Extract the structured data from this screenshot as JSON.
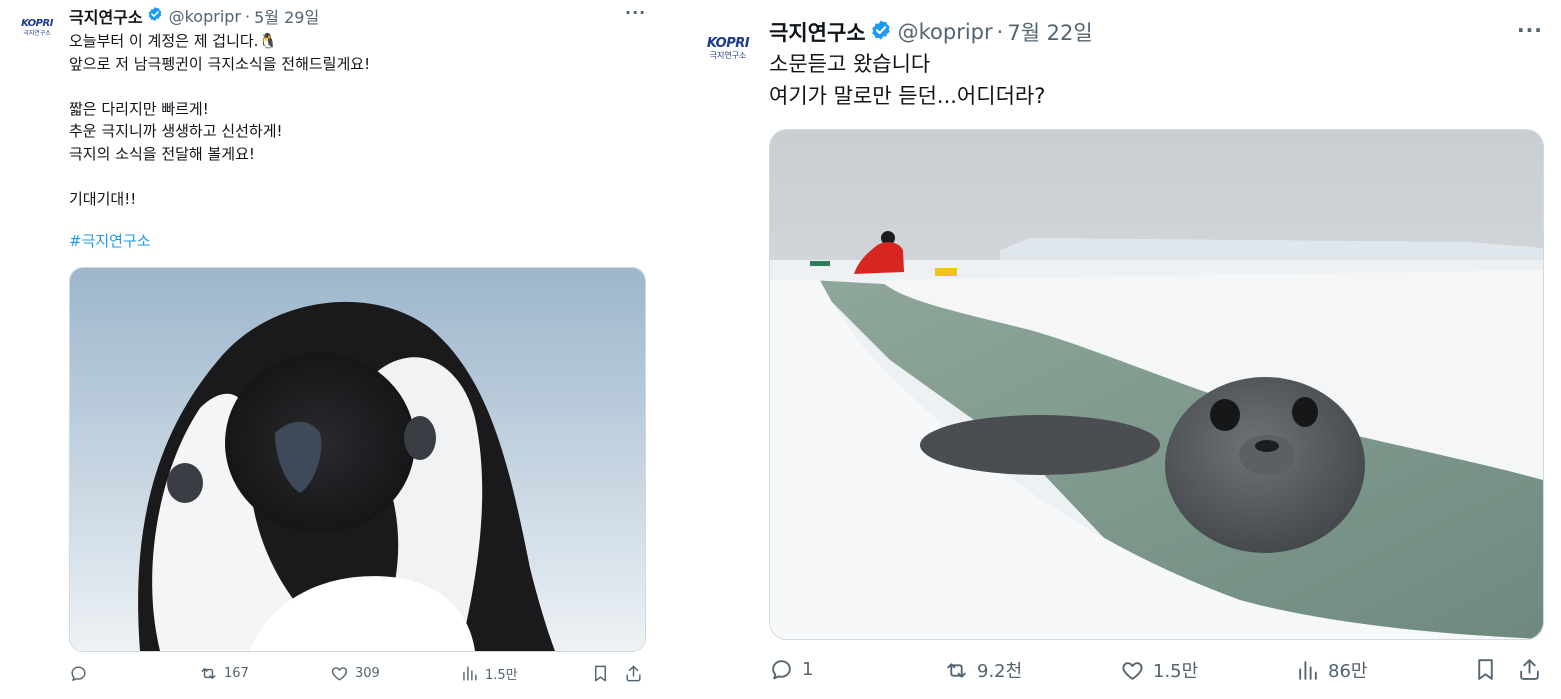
{
  "tweets": [
    {
      "logo_text": "KOPRI",
      "logo_sub": "극지연구소",
      "author_name": "극지연구소",
      "handle": "@kopripr",
      "separator": "·",
      "date": "5월 29일",
      "more": "···",
      "text": "오늘부터 이 계정은 제 겁니다.🐧\n앞으로 저 남극펭귄이 극지소식을 전해드릴게요!\n\n짧은 다리지만 빠르게!\n추운 극지니까 생생하고 신선하게!\n극지의 소식을 전달해 볼게요!\n\n기대기대!!",
      "hashtag": "#극지연구소",
      "stats": {
        "reply": "",
        "retweet": "167",
        "like": "309",
        "views": "1.5만"
      }
    },
    {
      "logo_text": "KOPRI",
      "logo_sub": "극지연구소",
      "author_name": "극지연구소",
      "handle": "@kopripr",
      "separator": "·",
      "date": "7월 22일",
      "more": "···",
      "text": "소문듣고 왔습니다\n여기가 말로만 듣던...어디더라?",
      "stats": {
        "reply": "1",
        "retweet": "9.2천",
        "like": "1.5만",
        "views": "86만"
      }
    }
  ],
  "colors": {
    "verified": "#1d9bf0",
    "hashtag": "#1d9bf0",
    "muted": "#536471",
    "text": "#0f1419",
    "brand": "#1d3b8f"
  },
  "icons": [
    "verified-badge-icon",
    "more-icon",
    "reply-icon",
    "retweet-icon",
    "like-icon",
    "views-icon",
    "bookmark-icon",
    "share-icon"
  ]
}
